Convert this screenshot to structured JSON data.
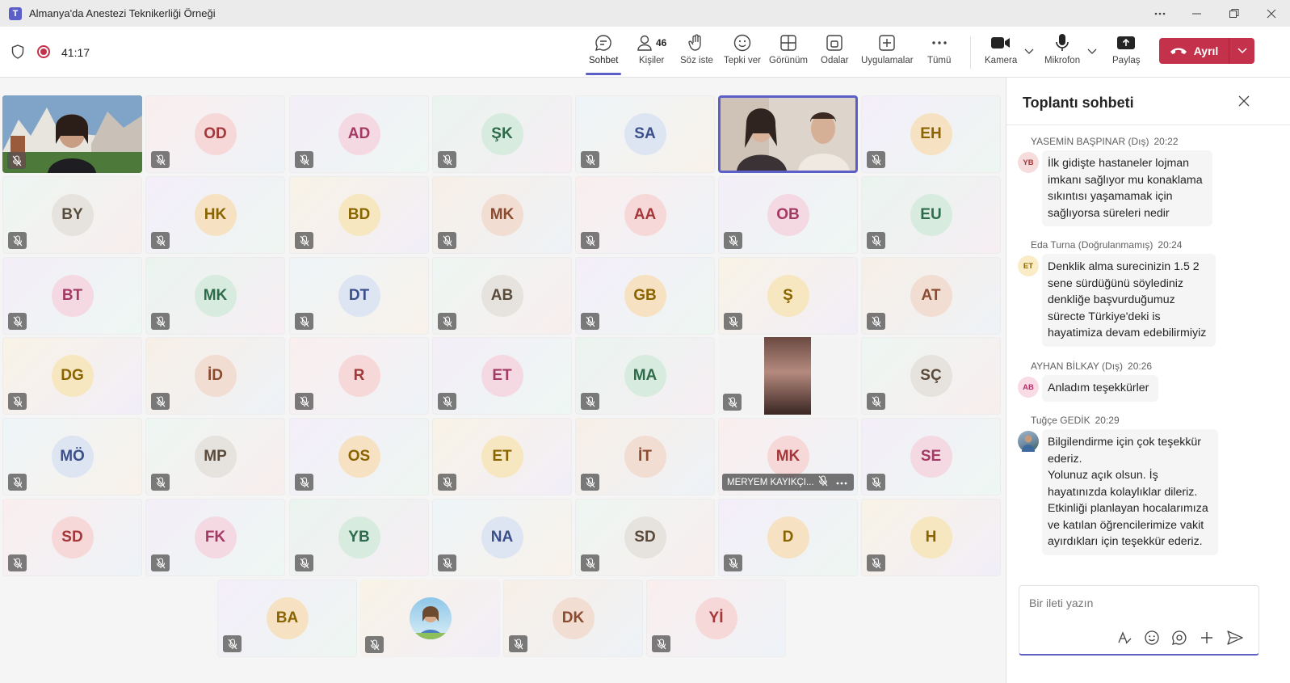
{
  "window": {
    "app_icon": "teams-logo",
    "title": "Almanya'da Anestezi Teknikerliği Örneği",
    "controls": [
      "more-icon",
      "minimize-icon",
      "restore-icon",
      "close-icon"
    ]
  },
  "toolbar": {
    "timer": "41:17",
    "items": [
      {
        "label": "Sohbet",
        "icon": "chat-icon",
        "active": true
      },
      {
        "label": "Kişiler",
        "icon": "people-icon",
        "count": "46"
      },
      {
        "label": "Söz iste",
        "icon": "raise-hand-icon"
      },
      {
        "label": "Tepki ver",
        "icon": "react-icon"
      },
      {
        "label": "Görünüm",
        "icon": "view-icon"
      },
      {
        "label": "Odalar",
        "icon": "rooms-icon"
      },
      {
        "label": "Uygulamalar",
        "icon": "apps-icon"
      },
      {
        "label": "Tümü",
        "icon": "more-icon"
      },
      {
        "label": "Kamera",
        "icon": "camera-icon"
      },
      {
        "label": "Mikrofon",
        "icon": "mic-icon"
      },
      {
        "label": "Paylaş",
        "icon": "share-icon"
      }
    ],
    "leave_label": "Ayrıl",
    "colors": {
      "accent": "#5b5fc7",
      "leave": "#c4314b"
    }
  },
  "grid": {
    "rows": [
      [
        "",
        "OD",
        "AD",
        "ŞK",
        "SA",
        "",
        "EH"
      ],
      [
        "BY",
        "HK",
        "BD",
        "MK",
        "AA",
        "OB",
        "EU"
      ],
      [
        "BT",
        "MK",
        "DT",
        "AB",
        "GB",
        "Ş",
        "AT"
      ],
      [
        "DG",
        "İD",
        "R",
        "ET",
        "MA",
        "",
        "SÇ"
      ],
      [
        "MÖ",
        "MP",
        "OS",
        "ET",
        "İT",
        "MK",
        "SE"
      ],
      [
        "SD",
        "FK",
        "YB",
        "NA",
        "SD",
        "D",
        "H"
      ],
      [
        "BA",
        "",
        "DK",
        "Yİ"
      ]
    ],
    "named_tile_label": "MERYEM KAYIKÇI..."
  },
  "chat": {
    "title": "Toplantı sohbeti",
    "messages": [
      {
        "author": "YASEMİN BAŞPINAR (Dış)",
        "time": "20:22",
        "initials": "YB",
        "text": [
          "İlk gidişte hastaneler lojman",
          "imkanı sağlıyor mu konaklama",
          "sıkıntısı yaşamamak için",
          "sağlıyorsa süreleri nedir"
        ]
      },
      {
        "author": "Eda Turna (Doğrulanmamış)",
        "time": "20:24",
        "initials": "ET",
        "text": [
          "Denklik alma surecinizin 1.5 2",
          "sene sürdüğünü söylediniz",
          "denkliğe başvurduğumuz",
          "sürecte Türkiye'deki is",
          "hayatimiza devam edebilirmiyiz"
        ]
      },
      {
        "author": "AYHAN BİLKAY (Dış)",
        "time": "20:26",
        "initials": "AB",
        "text": [
          "Anladım teşekkürler"
        ]
      },
      {
        "author": "Tuğçe GEDİK",
        "time": "20:29",
        "initials": "",
        "text": [
          "Bilgilendirme için çok teşekkür",
          "ederiz.",
          "Yolunuz açık olsun. İş",
          "hayatınızda kolaylıklar dileriz.",
          "Etkinliği planlayan hocalarımıza",
          "ve katılan öğrencilerimize vakit",
          "ayırdıkları için teşekkür ederiz."
        ]
      }
    ],
    "composer": {
      "placeholder": "Bir ileti yazın",
      "tools": [
        "format-icon",
        "emoji-icon",
        "loop-icon",
        "attach-plus-icon",
        "send-icon"
      ]
    }
  }
}
